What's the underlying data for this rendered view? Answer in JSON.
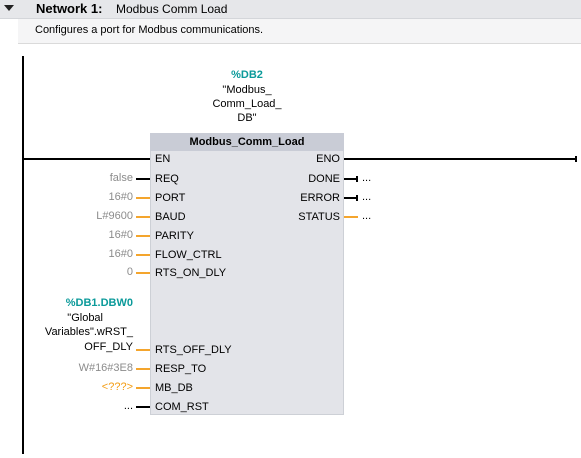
{
  "network": {
    "label": "Network 1:",
    "title": "Modbus Comm Load",
    "comment": "Configures a port for Modbus communications."
  },
  "instance_db": {
    "address": "%DB2",
    "name_lines": [
      "\"Modbus_",
      "Comm_Load_",
      "DB\""
    ]
  },
  "block": {
    "title": "Modbus_Comm_Load",
    "inputs": [
      {
        "pin": "EN",
        "value": ""
      },
      {
        "pin": "REQ",
        "value": "false"
      },
      {
        "pin": "PORT",
        "value": "16#0"
      },
      {
        "pin": "BAUD",
        "value": "L#9600"
      },
      {
        "pin": "PARITY",
        "value": "16#0"
      },
      {
        "pin": "FLOW_CTRL",
        "value": "16#0"
      },
      {
        "pin": "RTS_ON_DLY",
        "value": "0"
      },
      {
        "pin": "RTS_OFF_DLY",
        "value": ""
      },
      {
        "pin": "RESP_TO",
        "value": "W#16#3E8"
      },
      {
        "pin": "MB_DB",
        "value": "<???>"
      },
      {
        "pin": "COM_RST",
        "value": "..."
      }
    ],
    "outputs": [
      {
        "pin": "ENO",
        "value": ""
      },
      {
        "pin": "DONE",
        "value": "..."
      },
      {
        "pin": "ERROR",
        "value": "..."
      },
      {
        "pin": "STATUS",
        "value": "..."
      }
    ]
  },
  "global_var": {
    "address": "%DB1.DBW0",
    "name_lines": [
      "\"Global",
      "Variables\".wRST_",
      "OFF_DLY"
    ]
  },
  "colors": {
    "header_bg": "#e6e7ea",
    "block_bg": "#e3e4e9",
    "block_title_bg": "#c9ccd6",
    "teal": "#0b9a9a",
    "orange_wire": "#f4a52d",
    "missing_param": "#f39c12",
    "default_value": "#8c8c8c"
  }
}
